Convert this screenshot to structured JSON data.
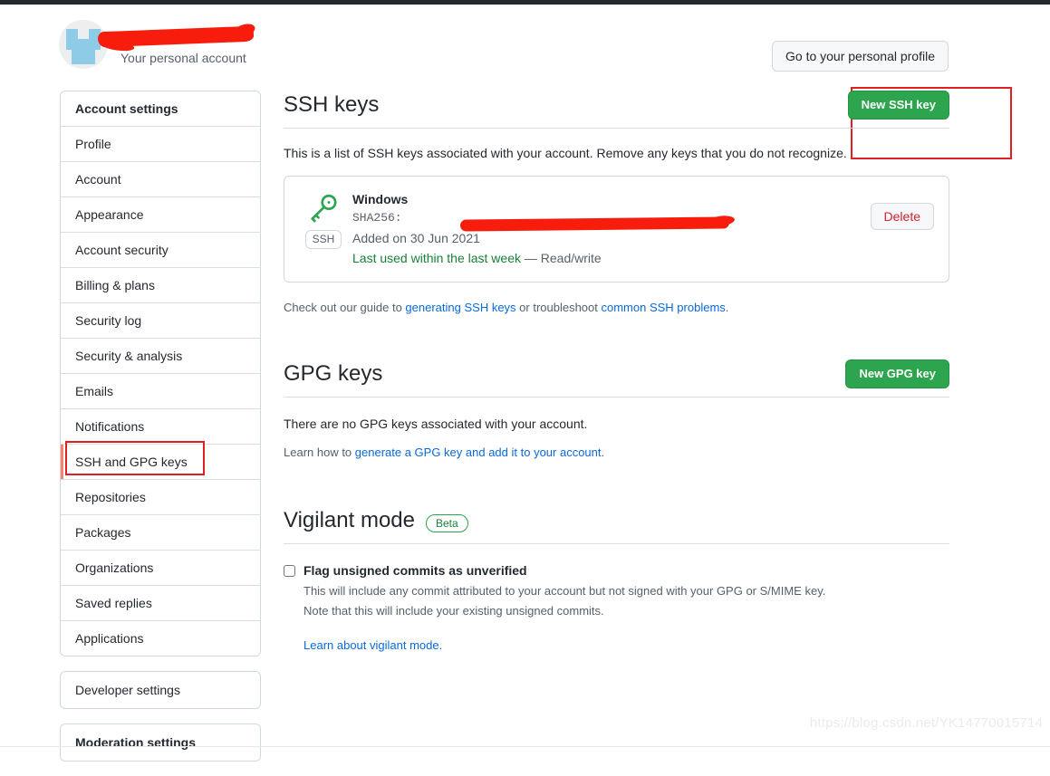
{
  "account": {
    "login_redacted": "",
    "subtitle": "Your personal account",
    "profile_button": "Go to your personal profile",
    "avatar_icon": "identicon-avatar"
  },
  "sidebar": {
    "group1": [
      {
        "label": "Account settings",
        "heading": true,
        "active": false
      },
      {
        "label": "Profile",
        "heading": false,
        "active": false
      },
      {
        "label": "Account",
        "heading": false,
        "active": false
      },
      {
        "label": "Appearance",
        "heading": false,
        "active": false
      },
      {
        "label": "Account security",
        "heading": false,
        "active": false
      },
      {
        "label": "Billing & plans",
        "heading": false,
        "active": false
      },
      {
        "label": "Security log",
        "heading": false,
        "active": false
      },
      {
        "label": "Security & analysis",
        "heading": false,
        "active": false
      },
      {
        "label": "Emails",
        "heading": false,
        "active": false
      },
      {
        "label": "Notifications",
        "heading": false,
        "active": false
      },
      {
        "label": "SSH and GPG keys",
        "heading": false,
        "active": true
      },
      {
        "label": "Repositories",
        "heading": false,
        "active": false
      },
      {
        "label": "Packages",
        "heading": false,
        "active": false
      },
      {
        "label": "Organizations",
        "heading": false,
        "active": false
      },
      {
        "label": "Saved replies",
        "heading": false,
        "active": false
      },
      {
        "label": "Applications",
        "heading": false,
        "active": false
      }
    ],
    "developer_settings": "Developer settings",
    "moderation_settings": "Moderation settings"
  },
  "ssh_section": {
    "title": "SSH keys",
    "new_button": "New SSH key",
    "description": "This is a list of SSH keys associated with your account. Remove any keys that you do not recognize.",
    "key": {
      "icon": "key-icon",
      "badge": "SSH",
      "title": "Windows",
      "fingerprint_prefix": "SHA256:",
      "fingerprint_redacted": "",
      "added": "Added on 30 Jun 2021",
      "last_used": "Last used within the last week",
      "access": "— Read/write",
      "delete_button": "Delete"
    },
    "guide_prefix": "Check out our guide to ",
    "guide_link1": "generating SSH keys",
    "guide_middle": " or troubleshoot ",
    "guide_link2": "common SSH problems",
    "guide_suffix": "."
  },
  "gpg_section": {
    "title": "GPG keys",
    "new_button": "New GPG key",
    "empty_text": "There are no GPG keys associated with your account.",
    "learn_prefix": "Learn how to ",
    "learn_link": "generate a GPG key and add it to your account",
    "learn_suffix": "."
  },
  "vigilant_section": {
    "title": "Vigilant mode",
    "badge": "Beta",
    "checkbox_label": "Flag unsigned commits as unverified",
    "checkbox_checked": false,
    "note_line1": "This will include any commit attributed to your account but not signed with your GPG or S/MIME key.",
    "note_line2": "Note that this will include your existing unsigned commits.",
    "learn_link": "Learn about vigilant mode."
  },
  "watermark": "https://blog.csdn.net/YK14770015714",
  "colors": {
    "green_button": "#2da44e",
    "annotation_red": "#e02020",
    "scribble_red": "#f81c0d",
    "link_blue": "#0969da",
    "danger_red": "#cf222e",
    "active_border": "#f9826c"
  }
}
